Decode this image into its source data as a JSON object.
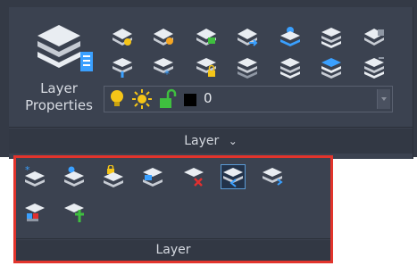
{
  "ribbon_panel": {
    "big_button": {
      "label": "Layer\nProperties",
      "icon": "layer-properties-icon"
    },
    "row1_icons": [
      "layer-state-icon",
      "layer-settings-icon",
      "layer-isolate-icon",
      "layer-walk-icon",
      "layer-current-icon",
      "layer-match-icon",
      "layer-merge-icon"
    ],
    "row2_icons": [
      "layer-unisolate-icon",
      "layer-freeze-icon",
      "layer-lock-icon",
      "layer-thaw-icon",
      "layer-previous-icon",
      "layer-copy-icon",
      "layer-change-icon"
    ],
    "layer_combo": {
      "icons": [
        "bulb-on-icon",
        "sun-icon",
        "unlock-icon"
      ],
      "color_swatch": "#000000",
      "value": "0"
    },
    "footer_label": "Layer",
    "footer_chevron": "⌄"
  },
  "flyout": {
    "row1_icons": [
      "layer-new-icon",
      "layer-walk-pin-icon",
      "layer-lock-all-icon",
      "layer-move-icon",
      "layer-delete-icon",
      "layer-merge-active-icon",
      "layer-translate-icon"
    ],
    "row2_icons": [
      "layer-color-icon",
      "layer-add-icon"
    ],
    "footer_label": "Layer"
  },
  "colors": {
    "ribbon_bg": "#343a46",
    "panel_bg": "#3b4250",
    "highlight_border": "#e2342c",
    "icon_light": "#e9edf2",
    "icon_dark": "#8f97a4",
    "accent_yellow": "#f5c518",
    "accent_blue": "#3aa0ff",
    "accent_green": "#3fbf3f",
    "accent_red": "#e03030"
  }
}
